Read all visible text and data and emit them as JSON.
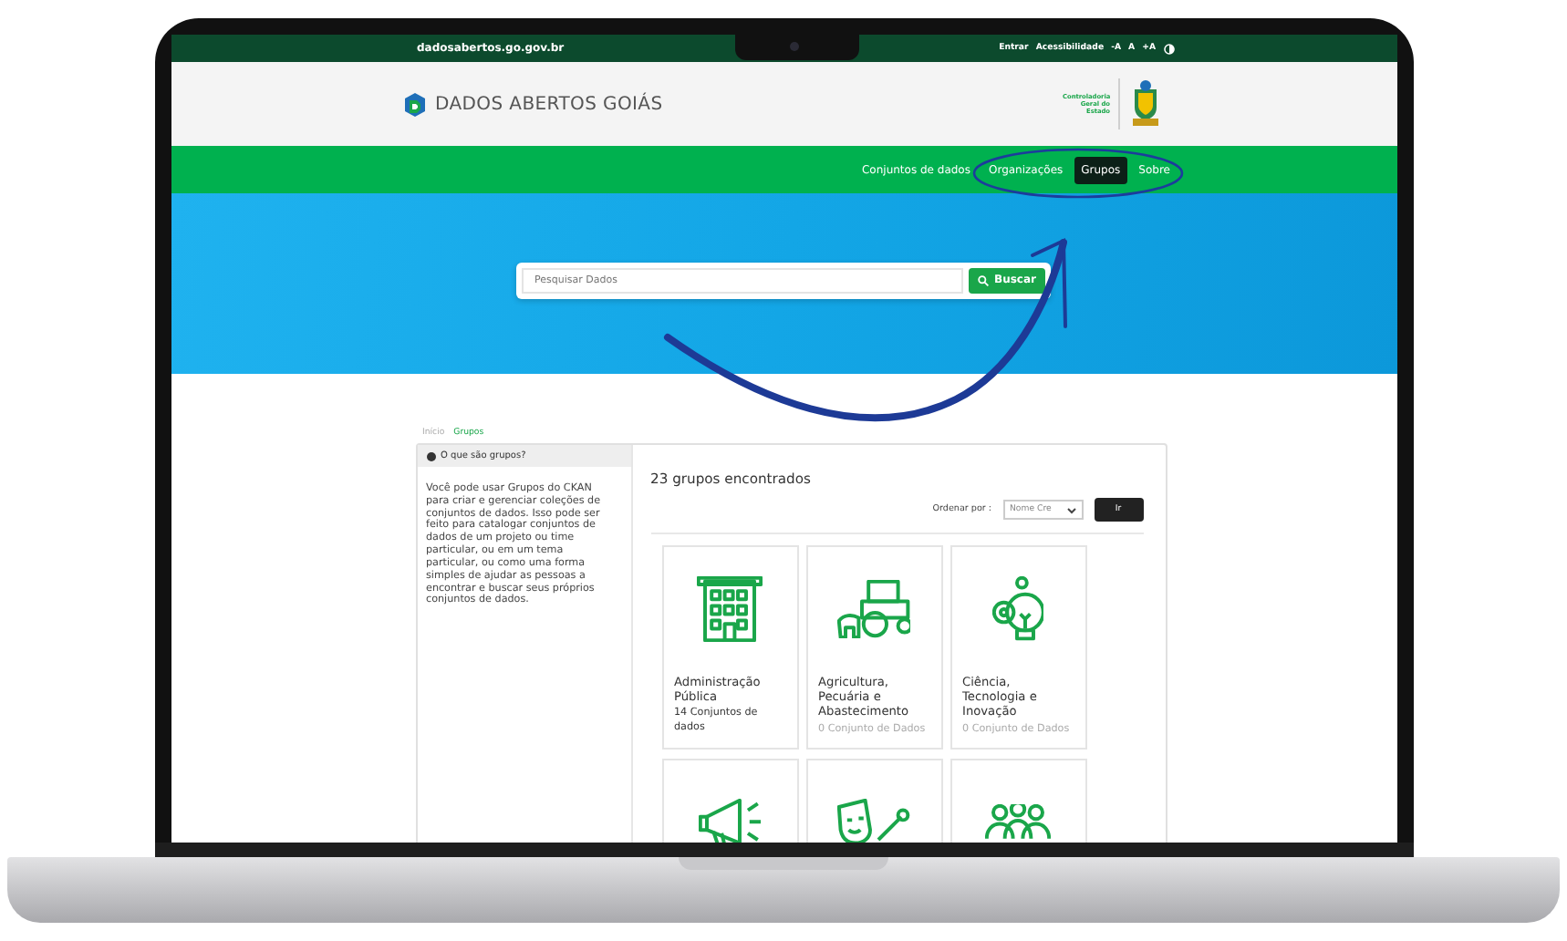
{
  "topbar": {
    "url": "dadosabertos.go.gov.br",
    "links": [
      "Entrar",
      "Acessibilidade",
      "-A",
      "A",
      "+A"
    ]
  },
  "header": {
    "logo": "DADOS ABERTOS GOIÁS",
    "emblem_caption": "Controladoria Geral do Estado"
  },
  "nav": [
    {
      "label": "Conjuntos de dados",
      "selected": false
    },
    {
      "label": "Organizações",
      "selected": false
    },
    {
      "label": "Grupos",
      "selected": true
    },
    {
      "label": "Sobre",
      "selected": false
    }
  ],
  "search": {
    "placeholder": "Pesquisar Dados",
    "button": "Buscar"
  },
  "breadcrumb": [
    "Início",
    "Grupos"
  ],
  "sidebar": {
    "title": "O que são grupos?",
    "text": "Você pode usar Grupos do CKAN para criar e gerenciar coleções de conjuntos de dados. Isso pode ser feito para catalogar conjuntos de dados de um projeto ou time particular, ou em um tema particular, ou como uma forma simples de ajudar as pessoas a encontrar e buscar seus próprios conjuntos de dados."
  },
  "results": {
    "count": "23 grupos encontrados",
    "sort_label": "Ordenar por :",
    "sort_value": "Nome Cre",
    "go_button": "Ir"
  },
  "groups": [
    {
      "kind": "building",
      "name": "Administração Pública",
      "count": "14 Conjuntos de dados",
      "muted": false
    },
    {
      "kind": "tractor",
      "name": "Agricultura, Pecuária e Abastecimento",
      "count": "0 Conjunto de Dados",
      "muted": true
    },
    {
      "kind": "gear-bulb",
      "name": "Ciência, Tecnologia e Inovação",
      "count": "0 Conjunto de Dados",
      "muted": true
    },
    {
      "kind": "megaphone"
    },
    {
      "kind": "masks"
    },
    {
      "kind": "people"
    }
  ]
}
